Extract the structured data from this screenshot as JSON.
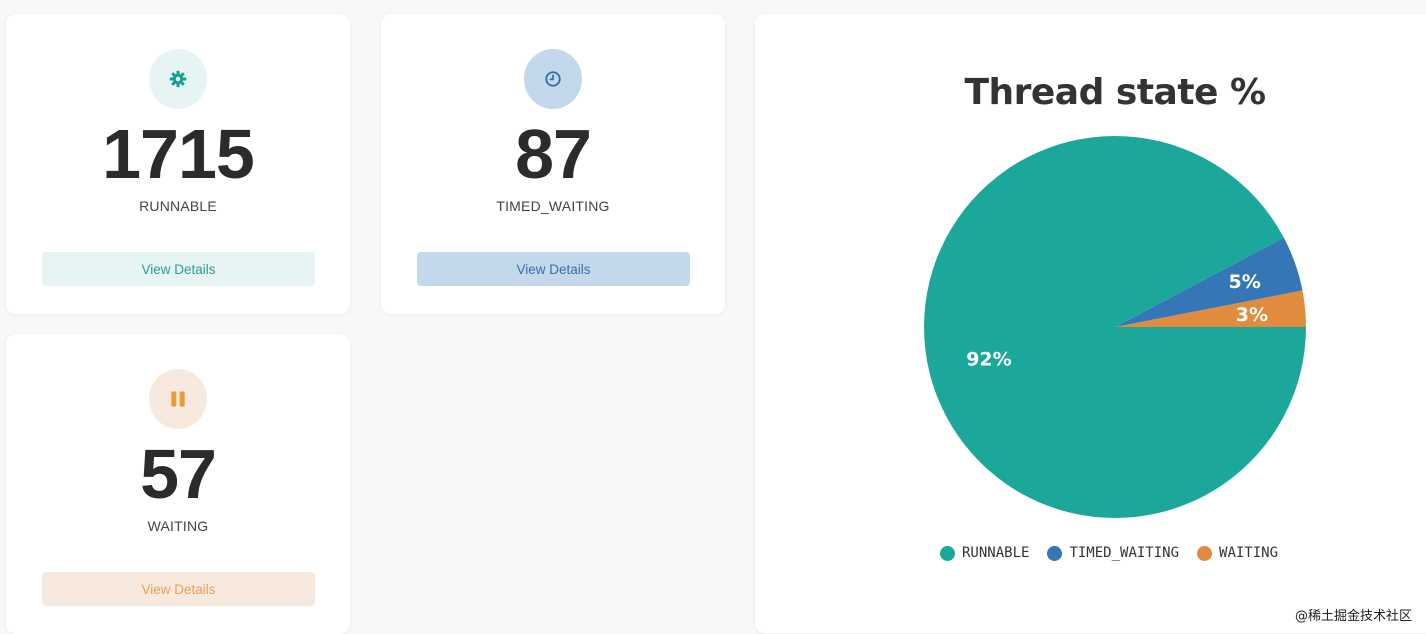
{
  "cards": [
    {
      "number": "1715",
      "label": "RUNNABLE",
      "button": "View Details",
      "icon": "gear-icon",
      "accent": "#14a095",
      "circle_bg": "#e6f4f3",
      "button_bg": "#e6f4f3",
      "button_color": "#2a9d94"
    },
    {
      "number": "87",
      "label": "TIMED_WAITING",
      "button": "View Details",
      "icon": "clock-icon",
      "accent": "#2f6db0",
      "circle_bg": "#c4d8eb",
      "button_bg": "#c4d8eb",
      "button_color": "#3a6ea5"
    },
    {
      "number": "57",
      "label": "WAITING",
      "button": "View Details",
      "icon": "pause-icon",
      "accent": "#ec9b3b",
      "circle_bg": "#f7e9dd",
      "button_bg": "#f7e9dd",
      "button_color": "#eba052"
    }
  ],
  "chart": {
    "title": "Thread state %",
    "legend": [
      "RUNNABLE",
      "TIMED_WAITING",
      "WAITING"
    ],
    "slice_labels": [
      "92%",
      "5%",
      "3%"
    ]
  },
  "chart_data": {
    "type": "pie",
    "title": "Thread state %",
    "categories": [
      "RUNNABLE",
      "TIMED_WAITING",
      "WAITING"
    ],
    "values": [
      1715,
      87,
      57
    ],
    "percent_labels": [
      "92%",
      "5%",
      "3%"
    ],
    "colors": [
      "#1ba89b",
      "#3576b6",
      "#e08b3e"
    ],
    "legend_position": "bottom"
  },
  "watermark": "@稀土掘金技术社区"
}
